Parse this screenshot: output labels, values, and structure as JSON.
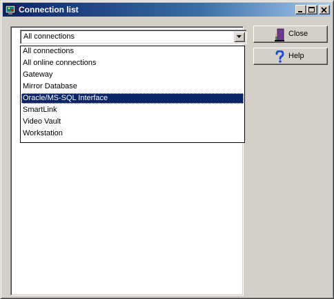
{
  "window": {
    "title": "Connection list",
    "colors": {
      "title_bar_start": "#0a246a",
      "title_bar_end": "#a6caf0",
      "selection": "#0a246a",
      "face": "#d4d0c8"
    }
  },
  "titlebar_buttons": {
    "minimize_icon": "minimize-icon",
    "maximize_icon": "maximize-icon",
    "close_icon": "close-icon"
  },
  "filter": {
    "selected_value": "All connections",
    "options": [
      "All connections",
      "All online connections",
      "Gateway",
      "Mirror Database",
      "Oracle/MS-SQL Interface",
      "SmartLink",
      "Video Vault",
      "Workstation"
    ],
    "highlighted": "Oracle/MS-SQL Interface"
  },
  "buttons": {
    "close_label": "Close",
    "close_icon": "door-exit-icon",
    "help_label": "Help",
    "help_icon": "question-mark-icon"
  }
}
